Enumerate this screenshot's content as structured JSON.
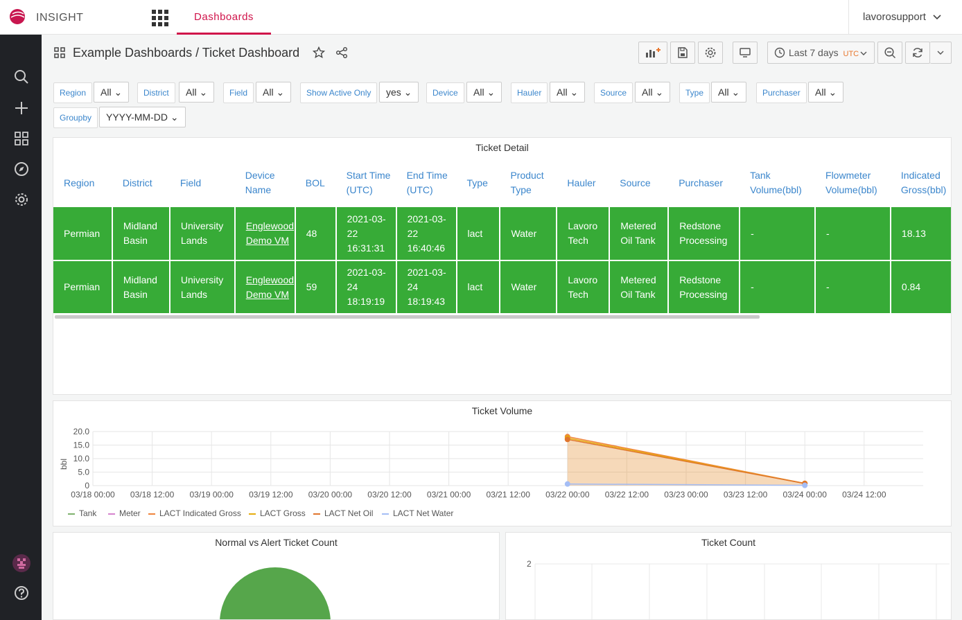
{
  "app": {
    "name": "INSIGHT",
    "nav_tab": "Dashboards",
    "user": "lavorosupport"
  },
  "breadcrumb": "Example Dashboards / Ticket Dashboard",
  "time_range": {
    "label": "Last 7 days",
    "tz": "UTC"
  },
  "variables": [
    {
      "label": "Region",
      "value": "All"
    },
    {
      "label": "District",
      "value": "All"
    },
    {
      "label": "Field",
      "value": "All"
    },
    {
      "label": "Show Active Only",
      "value": "yes"
    },
    {
      "label": "Device",
      "value": "All"
    },
    {
      "label": "Hauler",
      "value": "All"
    },
    {
      "label": "Source",
      "value": "All"
    },
    {
      "label": "Type",
      "value": "All"
    },
    {
      "label": "Purchaser",
      "value": "All"
    },
    {
      "label": "Groupby",
      "value": "YYYY-MM-DD"
    }
  ],
  "ticket_detail": {
    "title": "Ticket Detail",
    "columns": [
      "Region",
      "District",
      "Field",
      "Device Name",
      "BOL",
      "Start Time (UTC)",
      "End Time (UTC)",
      "Type",
      "Product Type",
      "Hauler",
      "Source",
      "Purchaser",
      "Tank Volume(bbl)",
      "Flowmeter Volume(bbl)",
      "Indicated Gross(bbl)"
    ],
    "rows": [
      [
        "Permian",
        "Midland Basin",
        "University Lands",
        "Englewood Demo VM",
        "48",
        "2021-03-22 16:31:31",
        "2021-03-22 16:40:46",
        "lact",
        "Water",
        "Lavoro Tech",
        "Metered Oil Tank",
        "Redstone Processing",
        "-",
        "-",
        "18.13"
      ],
      [
        "Permian",
        "Midland Basin",
        "University Lands",
        "Englewood Demo VM",
        "59",
        "2021-03-24 18:19:19",
        "2021-03-24 18:19:43",
        "lact",
        "Water",
        "Lavoro Tech",
        "Metered Oil Tank",
        "Redstone Processing",
        "-",
        "-",
        "0.84"
      ]
    ]
  },
  "ticket_volume": {
    "title": "Ticket Volume",
    "chart_data": {
      "type": "area",
      "title": "Ticket Volume",
      "ylabel": "bbl",
      "ylim": [
        0,
        20
      ],
      "yticks": [
        "0",
        "5.0",
        "10.0",
        "15.0",
        "20.0"
      ],
      "xticks": [
        "03/18 00:00",
        "03/18 12:00",
        "03/19 00:00",
        "03/19 12:00",
        "03/20 00:00",
        "03/20 12:00",
        "03/21 00:00",
        "03/21 12:00",
        "03/22 00:00",
        "03/22 12:00",
        "03/23 00:00",
        "03/23 12:00",
        "03/24 00:00",
        "03/24 12:00"
      ],
      "grid": true,
      "legend": "bottom",
      "series": [
        {
          "name": "Tank",
          "color": "#7eb26d",
          "points": []
        },
        {
          "name": "Meter",
          "color": "#d683ce",
          "points": []
        },
        {
          "name": "LACT Indicated Gross",
          "color": "#ef843c",
          "points": [
            [
              "03/22 00:00",
              18.13
            ],
            [
              "03/24 00:00",
              0.84
            ]
          ]
        },
        {
          "name": "LACT Gross",
          "color": "#e5ac0e",
          "points": [
            [
              "03/22 00:00",
              17.6
            ],
            [
              "03/24 00:00",
              0.8
            ]
          ]
        },
        {
          "name": "LACT Net Oil",
          "color": "#e0752d",
          "points": [
            [
              "03/22 00:00",
              17.1
            ],
            [
              "03/24 00:00",
              0.78
            ]
          ]
        },
        {
          "name": "LACT Net Water",
          "color": "#a4bdf5",
          "points": [
            [
              "03/22 00:00",
              0.6
            ],
            [
              "03/24 00:00",
              0.1
            ]
          ]
        }
      ]
    }
  },
  "normal_vs_alert": {
    "title": "Normal vs Alert Ticket Count"
  },
  "ticket_count": {
    "title": "Ticket Count",
    "ytick": "2"
  }
}
